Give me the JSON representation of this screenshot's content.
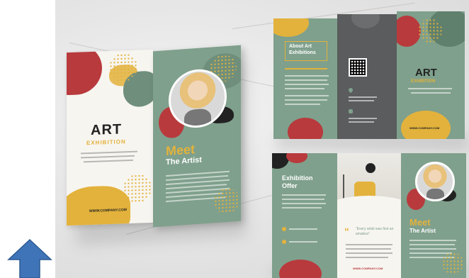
{
  "colors": {
    "sage": "#7fa08c",
    "red": "#b83a3d",
    "yellow": "#e3b23c",
    "arrow": "#3f75b8"
  },
  "front_left": {
    "title": "ART",
    "subtitle": "EXHIBITION",
    "website": "WWW.COMPANY.COM"
  },
  "front_right": {
    "title": "Meet",
    "subtitle": "The Artist"
  },
  "top_trifold": {
    "about_heading_line1": "About Art",
    "about_heading_line2": "Exhibitions",
    "back_title": "ART",
    "back_subtitle": "EXHIBITION",
    "website": "WWW.COMPANY.COM"
  },
  "bottom_trifold": {
    "offer_line1": "Exhibition",
    "offer_line2": "Offer",
    "meet_title": "Meet",
    "meet_subtitle": "The Artist",
    "quote": "“Every artist was first an amateur”",
    "website": "WWW.COMPANY.COM"
  },
  "nav": {
    "icon": "up-arrow-icon"
  }
}
